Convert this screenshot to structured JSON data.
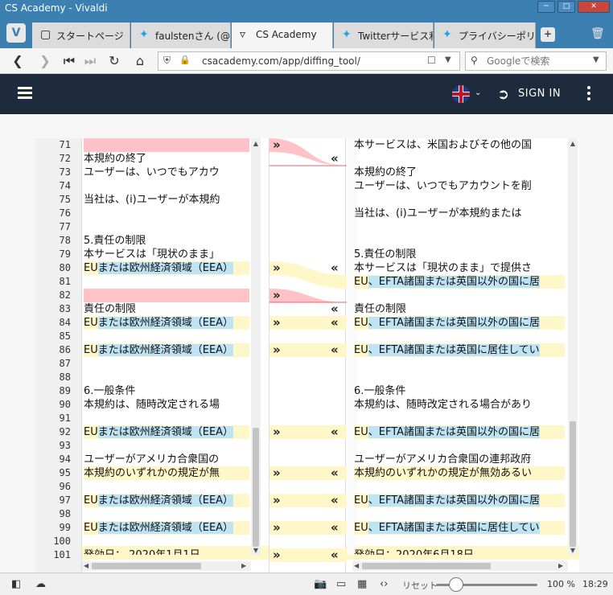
{
  "window": {
    "title": "CS Academy - Vivaldi"
  },
  "tabs": [
    {
      "label": "スタートページ",
      "icon": "vivaldi-icon"
    },
    {
      "label": "faulstenさん (@er",
      "icon": "twitter-icon"
    },
    {
      "label": "CS Academy",
      "icon": "csacademy-icon"
    },
    {
      "label": "Twitterサービス利",
      "icon": "twitter-icon"
    },
    {
      "label": "プライバシーポリシー",
      "icon": "twitter-icon"
    }
  ],
  "address": {
    "url": "csacademy.com/app/diffing_tool/"
  },
  "search": {
    "placeholder": "Googleで検索"
  },
  "header": {
    "signin": "SIGN IN"
  },
  "status": {
    "reset": "リセット",
    "zoom": "100 %",
    "time": "18:29"
  },
  "diff": {
    "line_numbers": [
      "71",
      "72",
      "73",
      "74",
      "75",
      "76",
      "77",
      "78",
      "79",
      "80",
      "81",
      "82",
      "83",
      "84",
      "85",
      "86",
      "87",
      "88",
      "89",
      "90",
      "91",
      "92",
      "93",
      "94",
      "95",
      "96",
      "97",
      "98",
      "99",
      "100",
      "101"
    ],
    "left": [
      {
        "text": "",
        "style": "pink"
      },
      {
        "text": "本規約の終了",
        "style": ""
      },
      {
        "text": "ユーザーは、いつでもアカウ",
        "style": ""
      },
      {
        "text": "",
        "style": ""
      },
      {
        "text": "当社は、(i)ユーザーが本規約",
        "style": ""
      },
      {
        "text": "",
        "style": ""
      },
      {
        "text": "",
        "style": ""
      },
      {
        "text": "5.責任の制限",
        "style": ""
      },
      {
        "text": "本サービスは「現状のまま」",
        "style": ""
      },
      {
        "text": "EUまたは欧州経済領域（EEA）",
        "style": "yellow",
        "hl": "または欧州経済領域（EEA）"
      },
      {
        "text": "",
        "style": ""
      },
      {
        "text": "",
        "style": "pink"
      },
      {
        "text": "責任の制限",
        "style": ""
      },
      {
        "text": "EUまたは欧州経済領域（EEA）",
        "style": "yellow",
        "hl": "または欧州経済領域（EEA）"
      },
      {
        "text": "",
        "style": ""
      },
      {
        "text": "EUまたは欧州経済領域（EEA）",
        "style": "yellow",
        "hl": "または欧州経済領域（EEA）"
      },
      {
        "text": "",
        "style": ""
      },
      {
        "text": "",
        "style": ""
      },
      {
        "text": "6.一般条件",
        "style": ""
      },
      {
        "text": "本規約は、随時改定される場",
        "style": ""
      },
      {
        "text": "",
        "style": ""
      },
      {
        "text": "EUまたは欧州経済領域（EEA）",
        "style": "yellow",
        "hl": "または欧州経済領域（EEA）"
      },
      {
        "text": "",
        "style": ""
      },
      {
        "text": "ユーザーがアメリカ合衆国の",
        "style": ""
      },
      {
        "text": "本規約のいずれかの規定が無",
        "style": "yellow"
      },
      {
        "text": "",
        "style": ""
      },
      {
        "text": "EUまたは欧州経済領域（EEA）",
        "style": "yellow",
        "hl": "または欧州経済領域（EEA）"
      },
      {
        "text": "",
        "style": ""
      },
      {
        "text": "EUまたは欧州経済領域（EEA）",
        "style": "yellow",
        "hl": "または欧州経済領域（EEA）"
      },
      {
        "text": "",
        "style": ""
      },
      {
        "text": "発効日： 2020年1月1日",
        "style": "yellow"
      }
    ],
    "right": [
      {
        "text": "本サービスは、米国およびその他の国",
        "style": ""
      },
      {
        "text": "",
        "style": ""
      },
      {
        "text": "本規約の終了",
        "style": ""
      },
      {
        "text": "ユーザーは、いつでもアカウントを削",
        "style": ""
      },
      {
        "text": "",
        "style": ""
      },
      {
        "text": "当社は、(i)ユーザーが本規約または",
        "style": ""
      },
      {
        "text": "",
        "style": ""
      },
      {
        "text": "",
        "style": ""
      },
      {
        "text": "5.責任の制限",
        "style": ""
      },
      {
        "text": "本サービスは「現状のまま」で提供さ",
        "style": ""
      },
      {
        "text": "EU、EFTA諸国または英国以外の国に居",
        "style": "yellow",
        "hl": "、EFTA諸国または英国以外の国に居"
      },
      {
        "text": "",
        "style": ""
      },
      {
        "text": "責任の制限",
        "style": ""
      },
      {
        "text": "EU、EFTA諸国または英国以外の国に居",
        "style": "yellow",
        "hl": "、EFTA諸国または英国以外の国に居"
      },
      {
        "text": "",
        "style": ""
      },
      {
        "text": "EU、EFTA諸国または英国に居住してい",
        "style": "yellow",
        "hl": "、EFTA諸国または英国に居住してい"
      },
      {
        "text": "",
        "style": ""
      },
      {
        "text": "",
        "style": ""
      },
      {
        "text": "6.一般条件",
        "style": ""
      },
      {
        "text": "本規約は、随時改定される場合があり",
        "style": ""
      },
      {
        "text": "",
        "style": ""
      },
      {
        "text": "EU、EFTA諸国または英国以外の国に居",
        "style": "yellow",
        "hl": "、EFTA諸国または英国以外の国に居"
      },
      {
        "text": "",
        "style": ""
      },
      {
        "text": "ユーザーがアメリカ合衆国の連邦政府",
        "style": ""
      },
      {
        "text": "本規約のいずれかの規定が無効あるい",
        "style": "yellow"
      },
      {
        "text": "",
        "style": ""
      },
      {
        "text": "EU、EFTA諸国または英国以外の国に居",
        "style": "yellow",
        "hl": "、EFTA諸国または英国以外の国に居"
      },
      {
        "text": "",
        "style": ""
      },
      {
        "text": "EU、EFTA諸国または英国に居住してい",
        "style": "yellow",
        "hl": "、EFTA諸国または英国に居住してい"
      },
      {
        "text": "",
        "style": ""
      },
      {
        "text": "発効日：2020年6月18日",
        "style": "yellow"
      }
    ],
    "connector_rows_with_arrows": [
      0,
      9,
      11,
      13,
      15,
      21,
      24,
      26,
      28,
      30
    ]
  }
}
